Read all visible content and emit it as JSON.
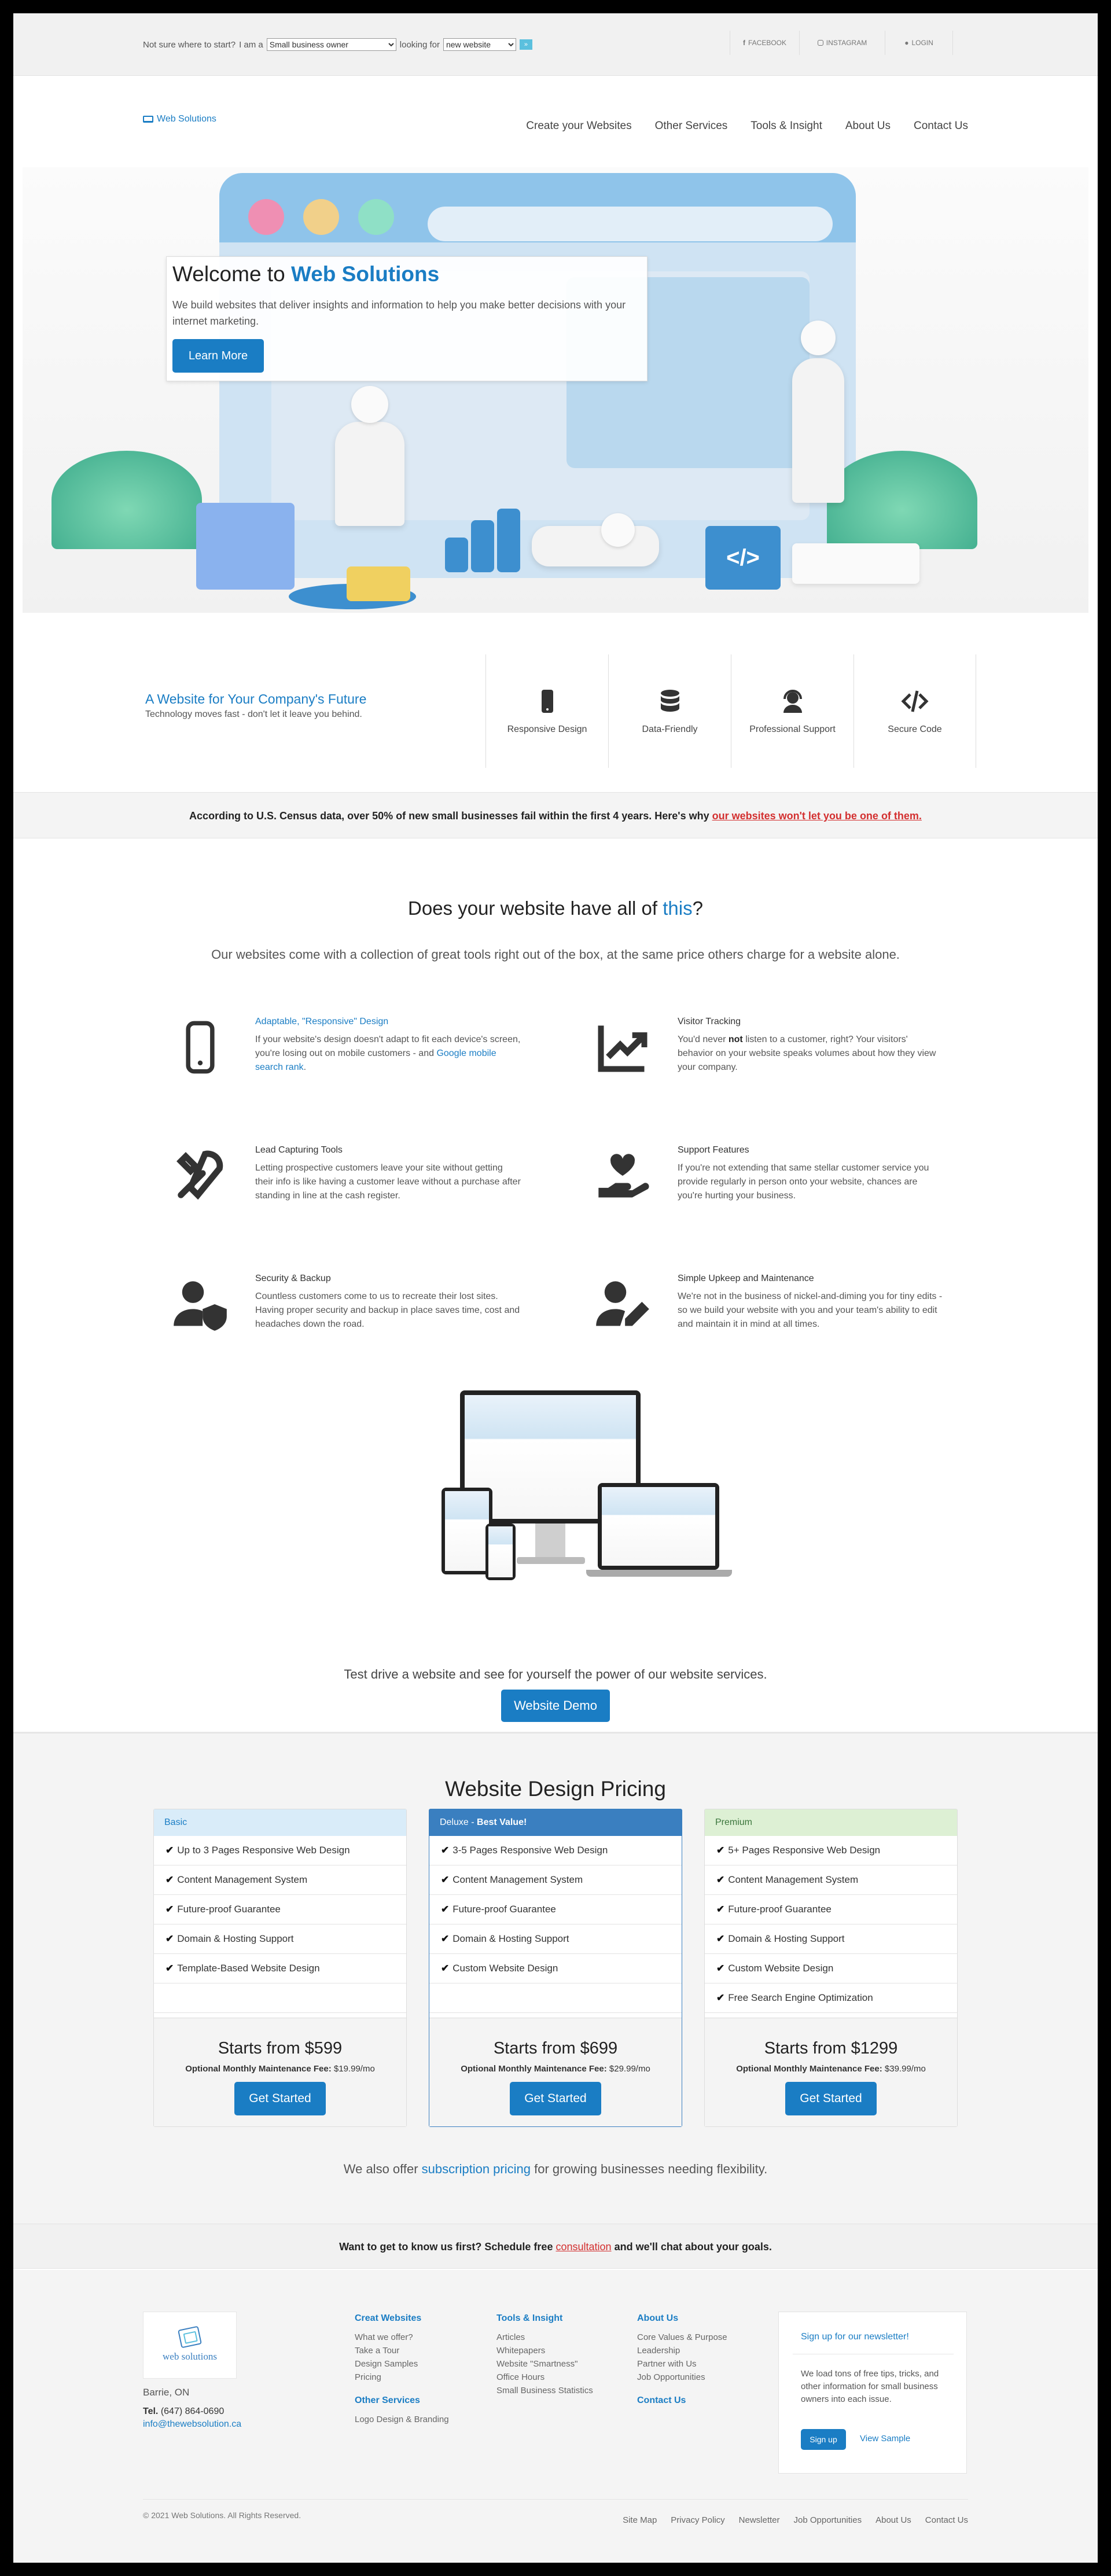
{
  "topbar": {
    "prompt_start": "Not sure where to start?",
    "i_am": "I am a",
    "role_selected": "Small business owner",
    "looking_for": "looking for",
    "need_selected": "new website",
    "go_label": "»",
    "facebook": "FACEBOOK",
    "instagram": "INSTAGRAM",
    "login": "LOGIN"
  },
  "nav": {
    "logo": "Web Solutions",
    "items": [
      "Create your Websites",
      "Other Services",
      "Tools & Insight",
      "About Us",
      "Contact Us"
    ]
  },
  "hero": {
    "title_prefix": "Welcome to",
    "title_brand": "Web Solutions",
    "text": "We build websites that deliver insights and information to help you make better decisions with your internet marketing.",
    "button": "Learn More"
  },
  "strip": {
    "title": "A Website for Your Company's Future",
    "subtitle": "Technology moves fast - don't let it leave you behind.",
    "features": [
      {
        "label": "Responsive Design",
        "icon": "mobile-icon"
      },
      {
        "label": "Data-Friendly",
        "icon": "database-icon"
      },
      {
        "label": "Professional Support",
        "icon": "headset-icon"
      },
      {
        "label": "Secure Code",
        "icon": "code-icon"
      }
    ]
  },
  "census": {
    "text": "According to U.S. Census data, over 50% of new small businesses fail within the first 4 years. Here's why",
    "link": "our websites won't let you be one of them."
  },
  "tools": {
    "title_prefix": "Does your website have all of",
    "title_link": "this",
    "title_suffix": "?",
    "subtitle": "Our websites come with a collection of great tools right out of the box, at the same price others charge for a website alone.",
    "items": [
      {
        "title": "Adaptable, \"Responsive\" Design",
        "p1": "If your website's design doesn't adapt to fit each device's screen, you're losing out on mobile customers - and ",
        "link": "Google mobile search rank",
        "p2": "."
      },
      {
        "title": "Visitor Tracking",
        "p1": "You'd never ",
        "bold": "not",
        "p2": " listen to a customer, right? Your visitors' behavior on your website speaks volumes about how they view your company."
      },
      {
        "title": "Lead Capturing Tools",
        "text": "Letting prospective customers leave your site without getting their info is like having a customer leave without a purchase after standing in line at the cash register."
      },
      {
        "title": "Support Features",
        "text": "If you're not extending that same stellar customer service you provide regularly in person onto your website, chances are you're hurting your business."
      },
      {
        "title": "Security & Backup",
        "text": "Countless customers come to us to recreate their lost sites. Having proper security and backup in place saves time, cost and headaches down the road."
      },
      {
        "title": "Simple Upkeep and Maintenance",
        "text": "We're not in the business of nickel-and-diming you for tiny edits - so we build your website with you and your team's ability to edit and maintain it in mind at all times."
      }
    ]
  },
  "demo": {
    "text": "Test drive a website and see for yourself the power of our website services.",
    "button": "Website Demo"
  },
  "pricing": {
    "title": "Website Design Pricing",
    "plans": [
      {
        "name": "Basic",
        "features": [
          "Up to 3 Pages Responsive Web Design",
          "Content Management System",
          "Future-proof Guarantee",
          "Domain & Hosting Support",
          "Template-Based Website Design"
        ],
        "price": "Starts from $599",
        "maint_label": "Optional Monthly Maintenance Fee:",
        "maint_value": "$19.99/mo",
        "button": "Get Started"
      },
      {
        "name": "Deluxe - ",
        "badge": "Best Value!",
        "features": [
          "3-5 Pages Responsive Web Design",
          "Content Management System",
          "Future-proof Guarantee",
          "Domain & Hosting Support",
          "Custom Website Design"
        ],
        "price": "Starts from $699",
        "maint_label": "Optional Monthly Maintenance Fee:",
        "maint_value": "$29.99/mo",
        "button": "Get Started"
      },
      {
        "name": "Premium",
        "features": [
          "5+ Pages Responsive Web Design",
          "Content Management System",
          "Future-proof Guarantee",
          "Domain & Hosting Support",
          "Custom Website Design",
          "Free Search Engine Optimization"
        ],
        "price": "Starts from $1299",
        "maint_label": "Optional Monthly Maintenance Fee:",
        "maint_value": "$39.99/mo",
        "button": "Get Started"
      }
    ],
    "subs_prefix": "We also offer",
    "subs_link": "subscription pricing",
    "subs_suffix": "for growing businesses needing flexibility."
  },
  "know": {
    "prefix": "Want to get to know us first? Schedule free",
    "link": "consultation",
    "suffix": "and we'll chat about your goals."
  },
  "footer": {
    "logo_text": "web solutions",
    "city": "Barrie, ON",
    "tel_label": "Tel.",
    "tel": "(647) 864-0690",
    "email": "info@thewebsolution.ca",
    "col1_title": "Creat Websites",
    "col1_items": [
      "What we offer?",
      "Take a Tour",
      "Design Samples",
      "Pricing"
    ],
    "col1_title2": "Other Services",
    "col1_items2": [
      "Logo Design & Branding"
    ],
    "col2_title": "Tools & Insight",
    "col2_items": [
      "Articles",
      "Whitepapers",
      "Website \"Smartness\"",
      "Office Hours",
      "Small Business Statistics"
    ],
    "col3_title": "About Us",
    "col3_items": [
      "Core Values & Purpose",
      "Leadership",
      "Partner with Us",
      "Job Opportunities"
    ],
    "col3_title2": "Contact Us",
    "newsletter_title": "Sign up for our newsletter!",
    "newsletter_text": "We load tons of free tips, tricks, and other information for small business owners into each issue.",
    "newsletter_button": "Sign up",
    "newsletter_sample": "View Sample",
    "copyright": "© 2021 Web Solutions. All Rights Reserved.",
    "links": [
      "Site Map",
      "Privacy Policy",
      "Newsletter",
      "Job Opportunities",
      "About Us",
      "Contact Us"
    ]
  },
  "colors": {
    "accent": "#1a7dc4",
    "alert": "#d32f2f",
    "background": "#f4f4f4"
  }
}
